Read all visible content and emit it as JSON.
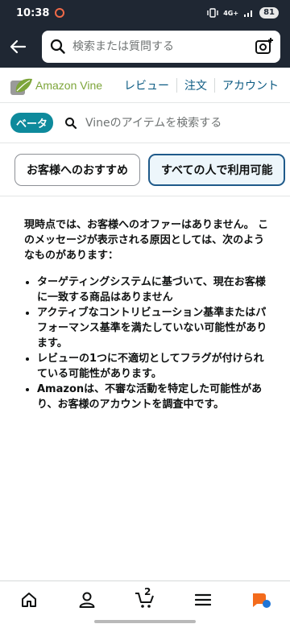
{
  "status_bar": {
    "time": "10:38",
    "network": "4G+",
    "battery": "81"
  },
  "header": {
    "search_placeholder": "検索または質問する"
  },
  "vine_nav": {
    "logo_text": "Amazon Vine",
    "links": [
      "レビュー",
      "注文",
      "アカウント"
    ]
  },
  "vine_search": {
    "badge": "ベータ",
    "placeholder": "Vineのアイテムを検索する"
  },
  "tabs": [
    {
      "label": "お客様へのおすすめ",
      "active": false
    },
    {
      "label": "すべての人で利用可能",
      "active": true
    }
  ],
  "message": {
    "intro": "現時点では、お客様へのオファーはありません。 このメッセージが表示される原因としては、次のようなものがあります：",
    "reasons": [
      "ターゲティングシステムに基づいて、現在お客様に一致する商品はありません",
      "アクティブなコントリビューション基準またはパフォーマンス基準を満たしていない可能性があります。",
      "レビューの1つに不適切としてフラグが付けられている可能性があります。",
      "Amazonは、不審な活動を特定した可能性があり、お客様のアカウントを調査中です。"
    ]
  },
  "bottom_nav": {
    "cart_count": "2",
    "items": [
      "home-icon",
      "account-icon",
      "cart-icon",
      "menu-icon",
      "rufus-icon"
    ]
  },
  "colors": {
    "header_bg": "#1f2733",
    "link": "#0b5a82",
    "badge": "#0e8a9c",
    "active_tab_border": "#1f5a8a"
  }
}
